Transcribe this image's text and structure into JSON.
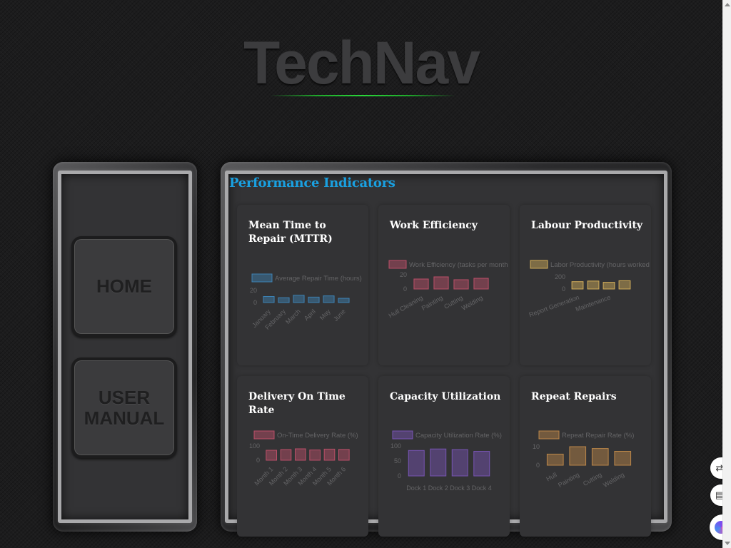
{
  "app": {
    "logo": "TechNav"
  },
  "nav": {
    "home": "HOME",
    "user_manual": "USER MANUAL"
  },
  "section": {
    "title": "Performance Indicators"
  },
  "cards": [
    {
      "title": "Mean Time to Repair (MTTR)",
      "color": "#3d85b8",
      "chart_data": {
        "type": "bar",
        "legend": "Average Repair Time (hours)",
        "categories": [
          "January",
          "February",
          "March",
          "April",
          "May",
          "June"
        ],
        "values": [
          10,
          8,
          12,
          9,
          11,
          7
        ],
        "yticks": [
          0,
          20
        ],
        "ylim": [
          0,
          40
        ]
      }
    },
    {
      "title": "Work Efficiency",
      "color": "#c0506a",
      "chart_data": {
        "type": "bar",
        "legend": "Work Efficiency (tasks per month",
        "categories": [
          "Hull Cleaning",
          "Painting",
          "Cutting",
          "Welding"
        ],
        "values": [
          14,
          17,
          13,
          15
        ],
        "yticks": [
          0,
          20
        ],
        "ylim": [
          0,
          30
        ]
      }
    },
    {
      "title": "Labour Productivity",
      "color": "#d8b25c",
      "chart_data": {
        "type": "bar",
        "legend": "Labor Productivity (hours worked",
        "categories": [
          "Report Generation",
          "Maintenance"
        ],
        "values": [
          120,
          130,
          110,
          135
        ],
        "yticks": [
          0,
          200
        ],
        "ylim": [
          0,
          350
        ]
      }
    },
    {
      "title": "Delivery On Time Rate",
      "color": "#c0506a",
      "chart_data": {
        "type": "bar",
        "legend": "On-Time Delivery Rate (%)",
        "categories": [
          "Month 1",
          "Month 2",
          "Month 3",
          "Month 4",
          "Month 5",
          "Month 6"
        ],
        "values": [
          70,
          75,
          80,
          72,
          78,
          76
        ],
        "yticks": [
          0,
          100
        ],
        "ylim": [
          0,
          150
        ]
      }
    },
    {
      "title": "Capacity Utilization",
      "color": "#7a55b8",
      "chart_data": {
        "type": "bar",
        "legend": "Capacity Utilization Rate (%)",
        "categories": [
          "Dock 1",
          "Dock 2",
          "Dock 3",
          "Dock 4"
        ],
        "values": [
          85,
          90,
          88,
          82
        ],
        "yticks": [
          0,
          50,
          100
        ],
        "ylim": [
          0,
          100
        ]
      }
    },
    {
      "title": "Repeat Repairs",
      "color": "#c08a4a",
      "chart_data": {
        "type": "bar",
        "legend": "Repeat Repair Rate (%)",
        "categories": [
          "Hull",
          "Painting",
          "Cutting",
          "Welding"
        ],
        "values": [
          6,
          10,
          9,
          7.5
        ],
        "yticks": [
          0,
          10
        ],
        "ylim": [
          0,
          10
        ]
      }
    }
  ]
}
